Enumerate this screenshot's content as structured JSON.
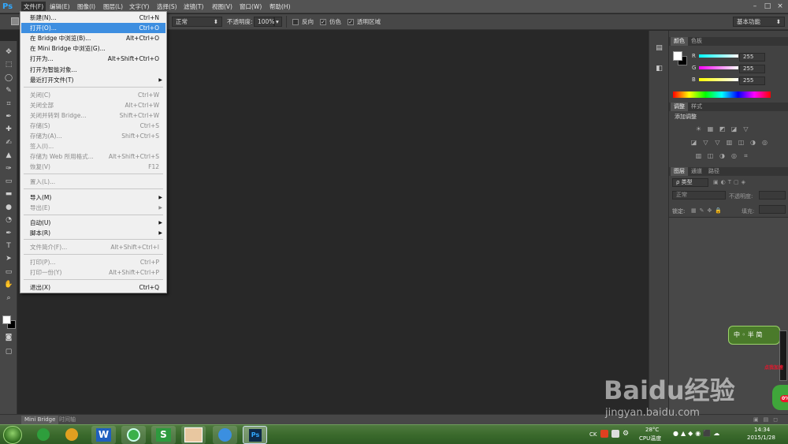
{
  "app": {
    "logo": "Ps"
  },
  "menubar": {
    "items": [
      "文件(F)",
      "编辑(E)",
      "图像(I)",
      "图层(L)",
      "文字(Y)",
      "选择(S)",
      "滤镜(T)",
      "视图(V)",
      "窗口(W)",
      "帮助(H)"
    ],
    "active_index": 0,
    "window_buttons": [
      "–",
      "□",
      "×"
    ]
  },
  "options_bar": {
    "mode": "正常",
    "opacity_label": "不透明度:",
    "opacity_value": "100%",
    "reverse_label": "反向",
    "dither_label": "仿色",
    "transparency_label": "透明区域",
    "workspace": "基本功能"
  },
  "file_menu": {
    "items": [
      {
        "label": "新建(N)...",
        "shortcut": "Ctrl+N",
        "enabled": true
      },
      {
        "label": "打开(O)...",
        "shortcut": "Ctrl+O",
        "enabled": true,
        "highlighted": true
      },
      {
        "label": "在 Bridge 中浏览(B)...",
        "shortcut": "Alt+Ctrl+O",
        "enabled": true
      },
      {
        "label": "在 Mini Bridge 中浏览(G)...",
        "shortcut": "",
        "enabled": true
      },
      {
        "label": "打开为...",
        "shortcut": "Alt+Shift+Ctrl+O",
        "enabled": true
      },
      {
        "label": "打开为智能对象...",
        "shortcut": "",
        "enabled": true
      },
      {
        "label": "最近打开文件(T)",
        "shortcut": "",
        "enabled": true,
        "submenu": true
      },
      {
        "label": "关闭(C)",
        "shortcut": "Ctrl+W",
        "enabled": false
      },
      {
        "label": "关闭全部",
        "shortcut": "Alt+Ctrl+W",
        "enabled": false
      },
      {
        "label": "关闭并转到 Bridge...",
        "shortcut": "Shift+Ctrl+W",
        "enabled": false
      },
      {
        "label": "存储(S)",
        "shortcut": "Ctrl+S",
        "enabled": false
      },
      {
        "label": "存储为(A)...",
        "shortcut": "Shift+Ctrl+S",
        "enabled": false
      },
      {
        "label": "签入(I)...",
        "shortcut": "",
        "enabled": false
      },
      {
        "label": "存储为 Web 所用格式...",
        "shortcut": "Alt+Shift+Ctrl+S",
        "enabled": false
      },
      {
        "label": "恢复(V)",
        "shortcut": "F12",
        "enabled": false
      },
      {
        "label": "置入(L)...",
        "shortcut": "",
        "enabled": false
      },
      {
        "label": "导入(M)",
        "shortcut": "",
        "enabled": true,
        "submenu": true
      },
      {
        "label": "导出(E)",
        "shortcut": "",
        "enabled": false,
        "submenu": true
      },
      {
        "label": "自动(U)",
        "shortcut": "",
        "enabled": true,
        "submenu": true
      },
      {
        "label": "脚本(R)",
        "shortcut": "",
        "enabled": true,
        "submenu": true
      },
      {
        "label": "文件简介(F)...",
        "shortcut": "Alt+Shift+Ctrl+I",
        "enabled": false
      },
      {
        "label": "打印(P)...",
        "shortcut": "Ctrl+P",
        "enabled": false
      },
      {
        "label": "打印一份(Y)",
        "shortcut": "Alt+Shift+Ctrl+P",
        "enabled": false
      },
      {
        "label": "退出(X)",
        "shortcut": "Ctrl+Q",
        "enabled": true
      }
    ]
  },
  "color_panel": {
    "tabs": [
      "颜色",
      "色板"
    ],
    "channels": [
      {
        "label": "R",
        "value": "255",
        "color": "#00ffff"
      },
      {
        "label": "G",
        "value": "255",
        "color": "#ff00ff"
      },
      {
        "label": "B",
        "value": "255",
        "color": "#ffff00"
      }
    ]
  },
  "adjust_panel": {
    "tabs": [
      "调整",
      "样式"
    ],
    "title": "添加调整"
  },
  "layers_panel": {
    "tabs": [
      "图层",
      "通道",
      "路径"
    ],
    "filter": "ρ 类型",
    "blend": "正常",
    "opacity_label": "不透明度:",
    "lock_label": "锁定:",
    "fill_label": "填充:"
  },
  "bottom_tabs": [
    "Mini Bridge",
    "时间轴"
  ],
  "taskbar": {
    "time": "14:34",
    "date": "2015/1/28",
    "temp": "28°C",
    "cpu": "CPU温度",
    "ime": "CK"
  },
  "widget": {
    "text": "中 ◦ 半 简",
    "badge": "点我加速",
    "percent": "0%"
  },
  "watermark": {
    "brand": "Baidu经验",
    "url": "jingyan.baidu.com"
  }
}
